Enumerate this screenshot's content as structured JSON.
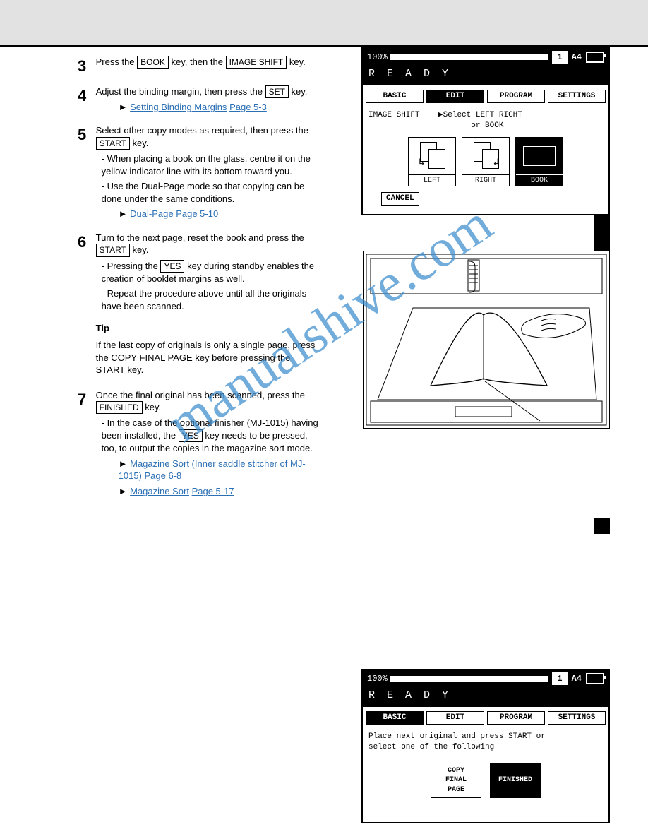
{
  "watermark": "manualshive.com",
  "steps": {
    "three": {
      "num": "3",
      "a": "Press the ",
      "btn1": "BOOK",
      "b": " key, then the ",
      "btn2": "IMAGE SHIFT",
      "c": " key."
    },
    "four": {
      "num": "4",
      "a": "Adjust the binding margin, then press the ",
      "btn1": "SET",
      "b": " key.",
      "see_label": "Setting Binding Margins",
      "see_page": " Page 5-3"
    },
    "five": {
      "num": "5",
      "a": "Select other copy modes as required, then press the ",
      "btn1": "START",
      "b": " key.",
      "note1": "- When placing a book on the glass, centre it on the yellow indicator line with its bottom toward you.",
      "note2_a": "- Use the Dual-Page mode so that copying can be done under the same conditions.",
      "see_label2": "Dual-Page",
      "see_page2": " Page 5-10"
    },
    "six": {
      "num": "6",
      "a": "Turn to the next page, reset the book and press the ",
      "btn1": "START",
      "b": " key.",
      "note_a": "- Pressing the ",
      "note_btn": "YES",
      "note_b": " key during standby enables the creation of booklet margins as well.",
      "cont": "- Repeat the procedure above until all the originals have been scanned.",
      "tip": "Tip",
      "tip_body": "If the last copy of originals is only a single page, press the COPY FINAL PAGE key before pressing the START key."
    },
    "seven": {
      "num": "7",
      "a": "Once the final original has been scanned, press the  ",
      "btn1": "FINISHED",
      "b": " key.",
      "note": "- In the case of the optional finisher (MJ-1015) having been installed, the ",
      "btn2": "YES",
      "note2": " key needs to be pressed, too, to output the copies in the magazine sort mode.",
      "see_magsort": "Magazine Sort (Inner saddle stitcher of MJ-1015)",
      "see_magsort_page": " Page 6-8",
      "see_magsort2": "Magazine Sort",
      "see_magsort2_page": " Page 5-17"
    }
  },
  "screen1": {
    "zoom": "100%",
    "count": "1",
    "size": "A4",
    "ready": "R E A D Y",
    "tabs": [
      "BASIC",
      "EDIT",
      "PROGRAM",
      "SETTINGS"
    ],
    "tabs_selected": 1,
    "hint_a": "IMAGE SHIFT",
    "hint_b": "▶Select LEFT RIGHT",
    "hint_c": "or BOOK",
    "opts": [
      "LEFT",
      "RIGHT",
      "BOOK"
    ],
    "opts_selected": 2,
    "cancel": "CANCEL"
  },
  "screen2": {
    "zoom": "100%",
    "count": "1",
    "size": "A4",
    "ready": "R E A D Y",
    "tabs": [
      "BASIC",
      "EDIT",
      "PROGRAM",
      "SETTINGS"
    ],
    "tabs_selected": 0,
    "hint1": "Place next original and press START or",
    "hint2": "select one of the following",
    "opts": [
      {
        "l1": "COPY",
        "l2": "FINAL",
        "l3": "PAGE"
      },
      {
        "l1": "FINISHED"
      }
    ],
    "opts_selected": 1
  }
}
